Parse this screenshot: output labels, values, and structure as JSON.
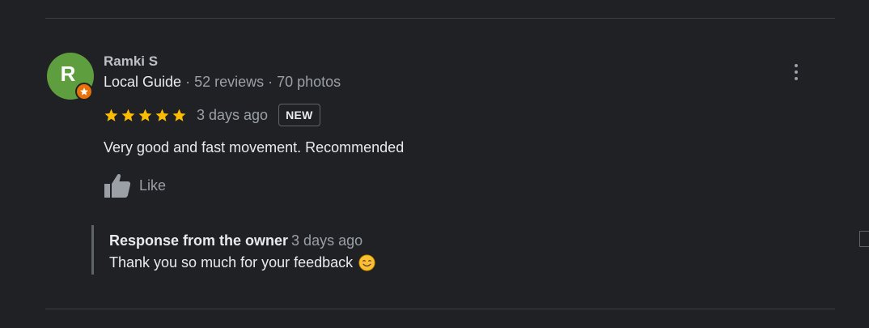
{
  "review": {
    "author": "Ramki S",
    "avatar_letter": "R",
    "guide_label": "Local Guide",
    "stats": " · 52 reviews · 70 photos",
    "rating": 5,
    "date": "3 days ago",
    "new_badge": "NEW",
    "text": "Very good and fast movement. Recommended",
    "like_label": "Like"
  },
  "owner_response": {
    "title": "Response from the owner",
    "date": "3 days ago",
    "text": "Thank you so much for your feedback"
  },
  "colors": {
    "background": "#202124",
    "avatar": "#5f9e3e",
    "star": "#fbbc04",
    "guide_badge": "#e8710a"
  },
  "icons": {
    "menu": "more-vert-icon",
    "like": "thumb-up-icon",
    "badge": "local-guide-star-icon",
    "emoji": "smiling-face-icon"
  }
}
